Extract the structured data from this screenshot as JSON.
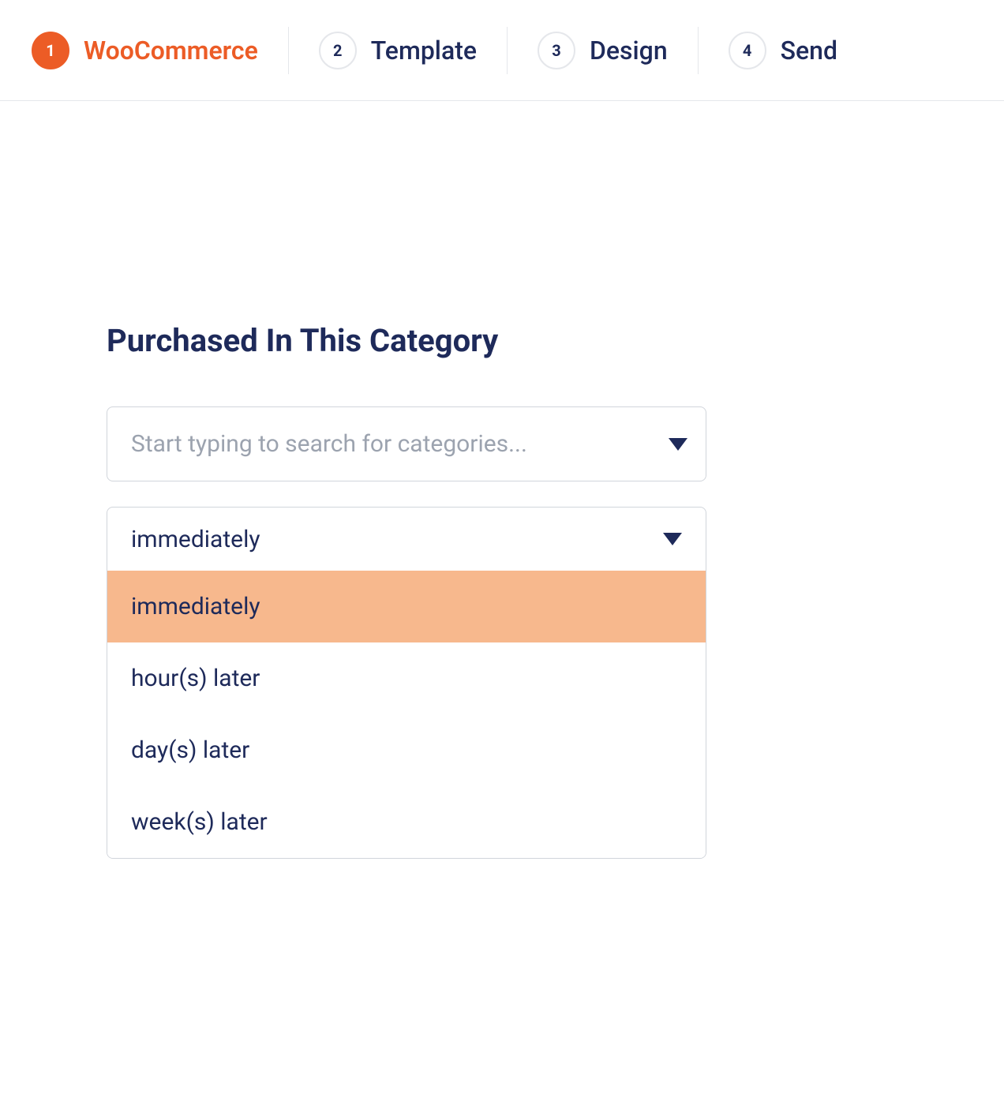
{
  "stepper": {
    "steps": [
      {
        "number": "1",
        "label": "WooCommerce",
        "active": true
      },
      {
        "number": "2",
        "label": "Template",
        "active": false
      },
      {
        "number": "3",
        "label": "Design",
        "active": false
      },
      {
        "number": "4",
        "label": "Send",
        "active": false
      }
    ]
  },
  "section": {
    "title": "Purchased In This Category",
    "category_placeholder": "Start typing to search for categories...",
    "timing_selected": "immediately",
    "timing_options": [
      {
        "label": "immediately",
        "highlighted": true
      },
      {
        "label": "hour(s) later",
        "highlighted": false
      },
      {
        "label": "day(s) later",
        "highlighted": false
      },
      {
        "label": "week(s) later",
        "highlighted": false
      }
    ]
  }
}
